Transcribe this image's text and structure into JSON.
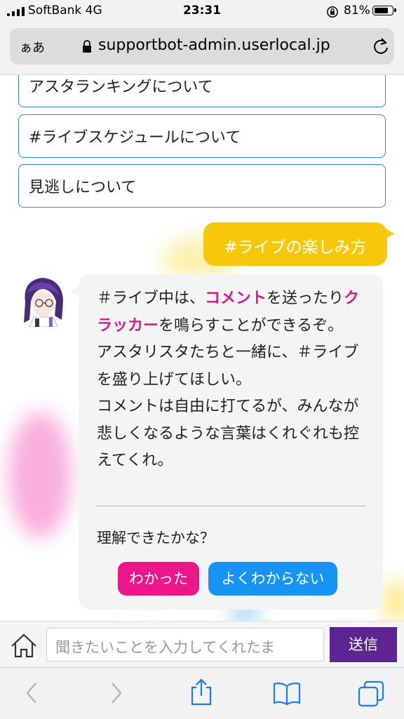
{
  "status_bar": {
    "carrier": "SoftBank  4G",
    "time": "23:31",
    "battery": "81%",
    "battery_level": 0.81
  },
  "address_bar": {
    "text_size_label": "ぁあ",
    "url": "supportbot-admin.userlocal.jp"
  },
  "chat": {
    "options": [
      {
        "label": "アスタランキングについて"
      },
      {
        "label": "#ライブスケジュールについて"
      },
      {
        "label": "見逃しについて"
      }
    ],
    "user_message": "#ライブの楽しみ方",
    "bot_message": {
      "p1_before": "＃ライブ中は、",
      "p1_hl1": "コメント",
      "p1_mid": "を送ったり",
      "p1_hl2": "クラッカー",
      "p1_after": "を鳴らすことができるぞ。",
      "p2": "アスタリスタたちと一緒に、＃ライブを盛り上げてほしい。",
      "p3": "コメントは自由に打てるが、みんなが悲しくなるような言葉はくれぐれも控えてくれ。",
      "question": "理解できたかな？",
      "reply_yes": "わかった",
      "reply_no": "よくわからない"
    }
  },
  "input_bar": {
    "placeholder": "聞きたいことを入力してくれたま",
    "send_label": "送信"
  },
  "colors": {
    "option_border": "#2a8ee8",
    "user_bubble": "#f7c80a",
    "highlight": "#e6168d",
    "yes_button": "#ec1589",
    "no_button": "#1793f3",
    "send_button": "#5c2592",
    "toolbar_icon": "#1a7cf5"
  }
}
